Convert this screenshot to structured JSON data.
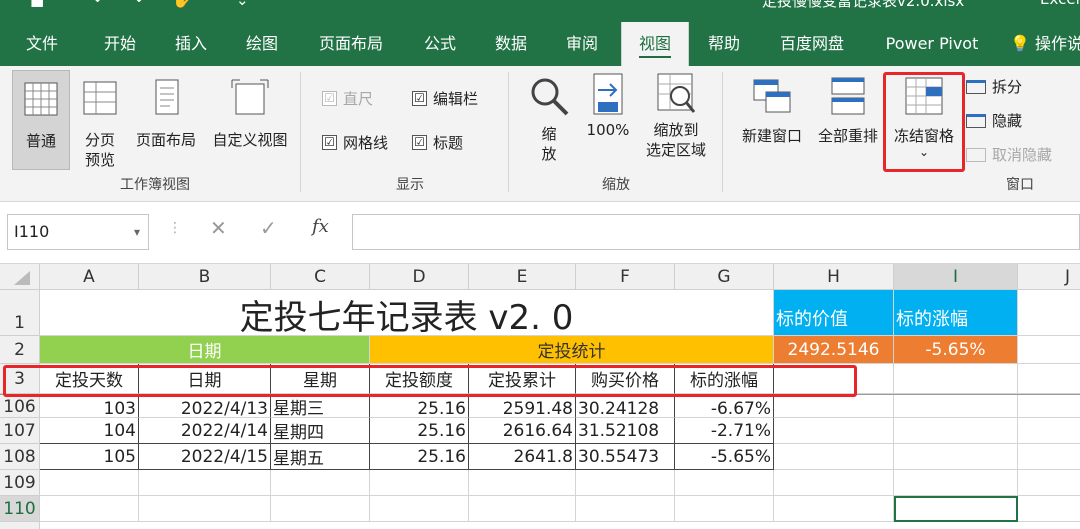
{
  "titlebar": {
    "title": "定投慢慢变富记录表v2.0.xlsx",
    "app": "Excel"
  },
  "tabs": [
    "文件",
    "开始",
    "插入",
    "绘图",
    "页面布局",
    "公式",
    "数据",
    "审阅",
    "视图",
    "帮助",
    "百度网盘",
    "Power Pivot",
    "操作说明搜索"
  ],
  "active_tab": "视图",
  "ribbon": {
    "workbook_views": {
      "normal": "普通",
      "page_break_1": "分页",
      "page_break_2": "预览",
      "page_layout": "页面布局",
      "custom": "自定义视图",
      "group": "工作簿视图"
    },
    "show": {
      "ruler": "直尺",
      "formula_bar": "编辑栏",
      "gridlines": "网格线",
      "headings": "标题",
      "group": "显示",
      "checked": "☑"
    },
    "zoom": {
      "zoom_1": "缩",
      "zoom_2": "放",
      "zoom_100": "100%",
      "zoom_sel_1": "缩放到",
      "zoom_sel_2": "选定区域",
      "group": "缩放"
    },
    "window": {
      "new_window": "新建窗口",
      "arrange_all": "全部重排",
      "freeze_panes": "冻结窗格",
      "freeze_arrow": "⌄",
      "split": "拆分",
      "hide": "隐藏",
      "unhide": "取消隐藏",
      "group": "窗口"
    }
  },
  "formula_bar": {
    "name_box": "I110",
    "dropdown": "▾",
    "cancel": "✕",
    "enter": "✓",
    "fx": "fx",
    "value": ""
  },
  "columns": [
    "A",
    "B",
    "C",
    "D",
    "E",
    "F",
    "G",
    "H",
    "I",
    "J"
  ],
  "rows": [
    "1",
    "2",
    "3",
    "106",
    "107",
    "108",
    "109",
    "110"
  ],
  "sheet": {
    "title": "定投七年记录表 v2. 0",
    "date_section": "日期",
    "stats_section": "定投统计",
    "h1_label": "标的价值",
    "i1_label": "标的涨幅",
    "h2_value": "2492.5146",
    "i2_value": "-5.65%",
    "headers": [
      "定投天数",
      "日期",
      "星期",
      "定投额度",
      "定投累计",
      "购买价格",
      "标的涨幅"
    ],
    "data_rows": [
      [
        "103",
        "2022/4/13",
        "星期三",
        "25.16",
        "2591.48",
        "30.24128",
        "-6.67%"
      ],
      [
        "104",
        "2022/4/14",
        "星期四",
        "25.16",
        "2616.64",
        "31.52108",
        "-2.71%"
      ],
      [
        "105",
        "2022/4/15",
        "星期五",
        "25.16",
        "2641.8",
        "30.55473",
        "-5.65%"
      ]
    ]
  },
  "colors": {
    "excel_green": "#217346",
    "blue": "#00b0f0",
    "green": "#92d050",
    "orange": "#ffc000",
    "dark_orange": "#ed7d31",
    "highlight": "#e8262a"
  }
}
